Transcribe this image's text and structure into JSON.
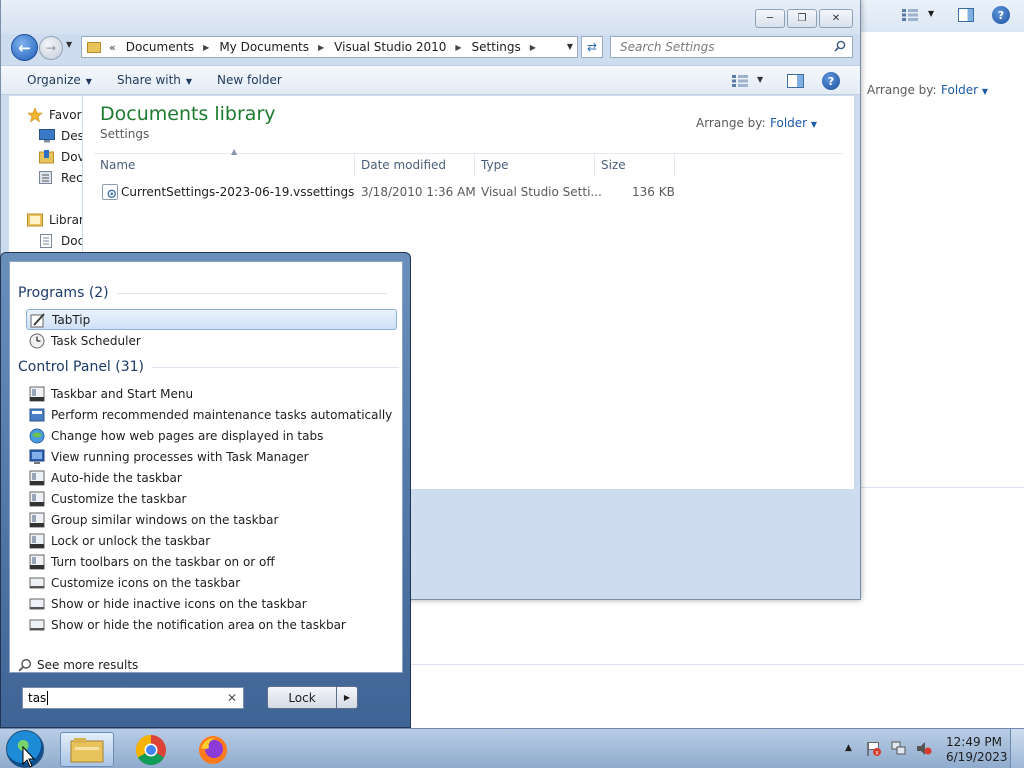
{
  "background_window": {
    "arrange_label": "Arrange by:",
    "arrange_value": "Folder"
  },
  "explorer": {
    "breadcrumbs": [
      "Documents",
      "My Documents",
      "Visual Studio 2010",
      "Settings"
    ],
    "search_placeholder": "Search Settings",
    "toolbar": {
      "organize": "Organize",
      "share_with": "Share with",
      "new_folder": "New folder"
    },
    "nav_pane": {
      "items": [
        {
          "label": "Favor",
          "icon": "star-icon"
        },
        {
          "label": "Des",
          "icon": "desktop-icon"
        },
        {
          "label": "Dov",
          "icon": "downloads-icon"
        },
        {
          "label": "Rec",
          "icon": "recent-places-icon"
        },
        {
          "label": "Librar",
          "icon": "libraries-icon"
        },
        {
          "label": "Doc",
          "icon": "documents-icon"
        }
      ]
    },
    "library": {
      "title": "Documents library",
      "subtitle": "Settings",
      "arrange_label": "Arrange by:",
      "arrange_value": "Folder"
    },
    "columns": [
      "Name",
      "Date modified",
      "Type",
      "Size"
    ],
    "files": [
      {
        "name": "CurrentSettings-2023-06-19.vssettings",
        "date": "3/18/2010 1:36 AM",
        "type": "Visual Studio Setti...",
        "size": "136 KB"
      }
    ]
  },
  "start_menu": {
    "programs_header": "Programs (2)",
    "programs": [
      {
        "label": "TabTip",
        "icon": "pen-icon",
        "selected": true
      },
      {
        "label": "Task Scheduler",
        "icon": "clock-icon",
        "selected": false
      }
    ],
    "control_panel_header": "Control Panel (31)",
    "control_panel": [
      {
        "label": "Taskbar and Start Menu",
        "icon": "taskbar-icon"
      },
      {
        "label": "Perform recommended maintenance tasks automatically",
        "icon": "action-center-icon"
      },
      {
        "label": "Change how web pages are displayed in tabs",
        "icon": "internet-options-icon"
      },
      {
        "label": "View running processes with Task Manager",
        "icon": "system-icon"
      },
      {
        "label": "Auto-hide the taskbar",
        "icon": "taskbar-icon"
      },
      {
        "label": "Customize the taskbar",
        "icon": "taskbar-icon"
      },
      {
        "label": "Group similar windows on the taskbar",
        "icon": "taskbar-icon"
      },
      {
        "label": "Lock or unlock the taskbar",
        "icon": "taskbar-icon"
      },
      {
        "label": "Turn toolbars on the taskbar on or off",
        "icon": "taskbar-icon"
      },
      {
        "label": "Customize icons on the taskbar",
        "icon": "notification-icon"
      },
      {
        "label": "Show or hide inactive icons on the taskbar",
        "icon": "notification-icon"
      },
      {
        "label": "Show or hide the notification area on the taskbar",
        "icon": "notification-icon"
      }
    ],
    "see_more": "See more results",
    "search_value": "tas",
    "lock_label": "Lock"
  },
  "taskbar": {
    "time": "12:49 PM",
    "date": "6/19/2023"
  }
}
